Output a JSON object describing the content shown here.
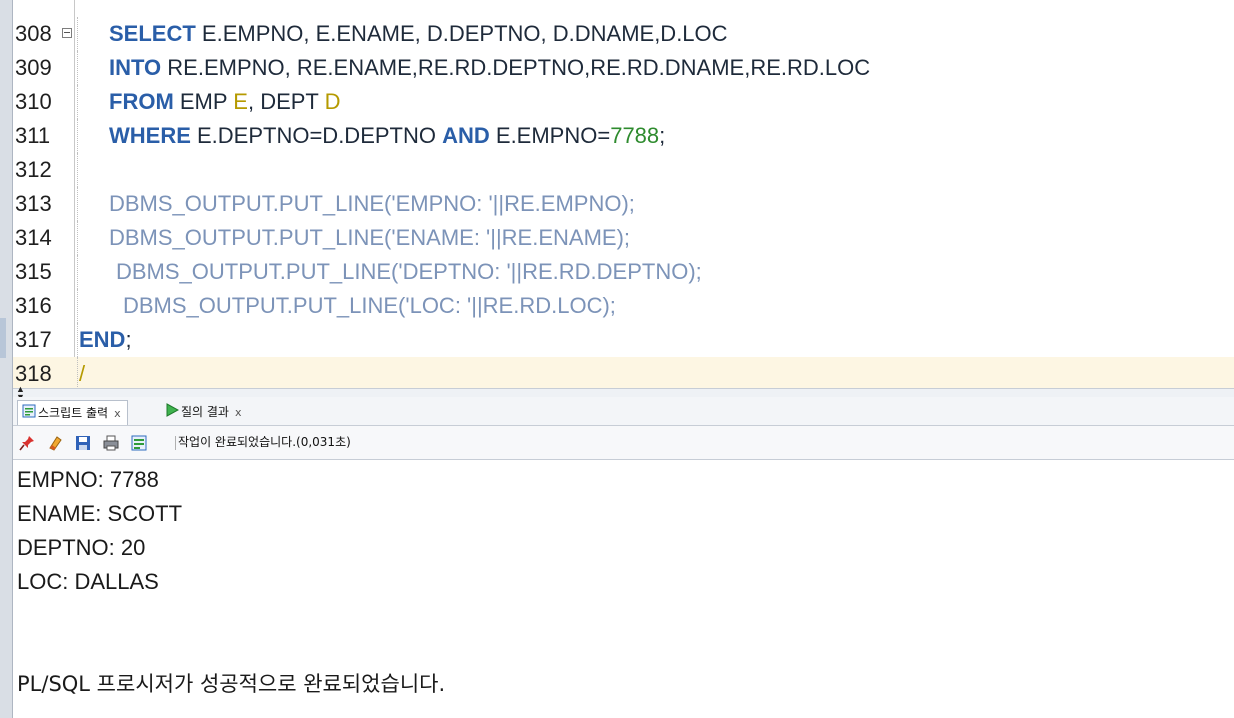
{
  "editor": {
    "lines": [
      {
        "no": "308",
        "fold": true,
        "indent": 96,
        "tokens": [
          {
            "t": "SELECT",
            "c": "kw"
          },
          {
            "t": " E.EMPNO, E.ENAME, D.DEPTNO, D.DNAME,D.LOC",
            "c": "tx"
          }
        ]
      },
      {
        "no": "309",
        "indent": 96,
        "tokens": [
          {
            "t": "INTO",
            "c": "kw"
          },
          {
            "t": " RE.EMPNO, RE.ENAME,RE.RD.DEPTNO,RE.RD.DNAME,RE.RD.LOC",
            "c": "tx"
          }
        ]
      },
      {
        "no": "310",
        "indent": 96,
        "tokens": [
          {
            "t": "FROM",
            "c": "kw"
          },
          {
            "t": " EMP ",
            "c": "tx"
          },
          {
            "t": "E",
            "c": "al"
          },
          {
            "t": ", DEPT ",
            "c": "tx"
          },
          {
            "t": "D",
            "c": "al"
          }
        ]
      },
      {
        "no": "311",
        "indent": 96,
        "tokens": [
          {
            "t": "WHERE",
            "c": "kw"
          },
          {
            "t": " E.DEPTNO=D.DEPTNO ",
            "c": "tx"
          },
          {
            "t": "AND",
            "c": "kw"
          },
          {
            "t": " E.EMPNO=",
            "c": "tx"
          },
          {
            "t": "7788",
            "c": "num"
          },
          {
            "t": ";",
            "c": "tx"
          }
        ]
      },
      {
        "no": "312",
        "indent": 96,
        "tokens": []
      },
      {
        "no": "313",
        "indent": 96,
        "tokens": [
          {
            "t": "DBMS_OUTPUT.PUT_LINE('EMPNO: '||RE.EMPNO);",
            "c": "dim"
          }
        ]
      },
      {
        "no": "314",
        "indent": 96,
        "tokens": [
          {
            "t": "DBMS_OUTPUT.PUT_LINE('ENAME: '||RE.ENAME);",
            "c": "dim"
          }
        ]
      },
      {
        "no": "315",
        "indent": 103,
        "tokens": [
          {
            "t": "DBMS_OUTPUT.PUT_LINE('DEPTNO: '||RE.RD.DEPTNO);",
            "c": "dim"
          }
        ]
      },
      {
        "no": "316",
        "indent": 110,
        "tokens": [
          {
            "t": "DBMS_OUTPUT.PUT_LINE('LOC: '||RE.RD.LOC);",
            "c": "dim"
          }
        ]
      },
      {
        "no": "317",
        "indent": 66,
        "tokens": [
          {
            "t": "END",
            "c": "kw"
          },
          {
            "t": ";",
            "c": "tx"
          }
        ]
      },
      {
        "no": "318",
        "indent": 66,
        "current": true,
        "tokens": [
          {
            "t": "/",
            "c": "al"
          }
        ]
      }
    ]
  },
  "panel": {
    "tabs": [
      {
        "label": "스크립트 출력",
        "close": "x",
        "icon": "script-output-icon",
        "active": true
      },
      {
        "label": "질의 결과",
        "close": "x",
        "icon": "run-query-icon",
        "active": false
      }
    ],
    "toolbar": {
      "buttons": [
        "pin-icon",
        "eraser-icon",
        "save-icon",
        "print-icon",
        "script-output-icon"
      ],
      "status": "작업이 완료되었습니다.(0,031초)"
    },
    "output": {
      "lines": [
        "EMPNO: 7788",
        "ENAME: SCOTT",
        "DEPTNO: 20",
        "LOC: DALLAS",
        "",
        "",
        "PL/SQL 프로시저가 성공적으로 완료되었습니다."
      ]
    }
  },
  "colors": {
    "keyword": "#2a5ea8",
    "text": "#1e2a3a",
    "alias": "#b59a00",
    "number": "#2e8b2e",
    "dimmed": "#7c93b8",
    "current_line": "#fdf6e3"
  }
}
